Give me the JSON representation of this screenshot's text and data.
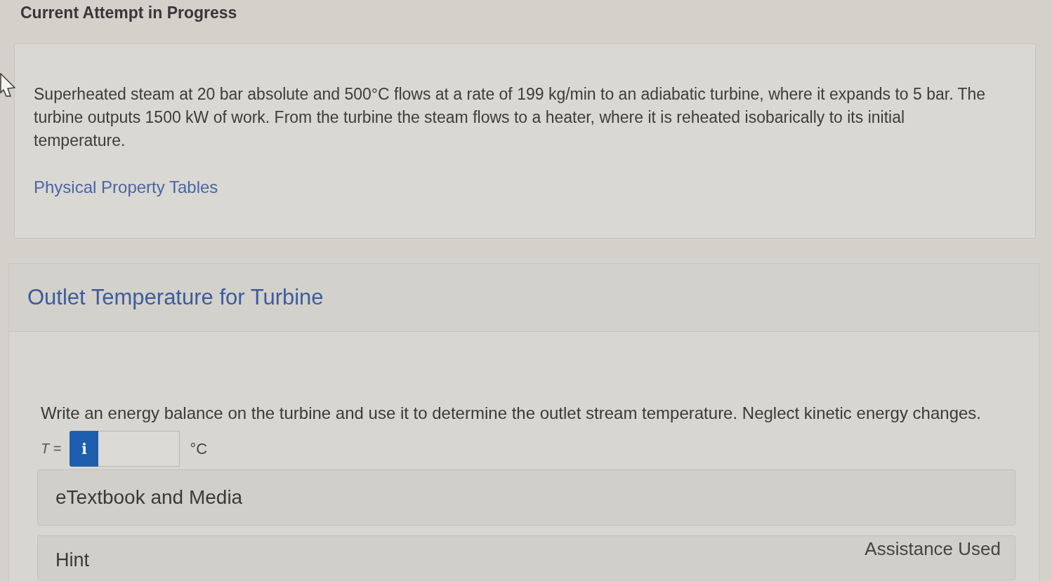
{
  "header": {
    "title": "Current Attempt in Progress"
  },
  "problem": {
    "text": "Superheated steam at 20 bar absolute and 500°C flows at a rate of 199 kg/min to an adiabatic turbine, where it expands to 5 bar. The turbine outputs 1500 kW of work. From the turbine the steam flows to a heater, where it is reheated isobarically to its initial temperature.",
    "link": "Physical Property Tables"
  },
  "part": {
    "title": "Outlet Temperature for Turbine",
    "question": "Write an energy balance on the turbine and use it to determine the outlet stream temperature. Neglect kinetic energy changes.",
    "answer": {
      "label": "*T* =",
      "info_button": "i",
      "unit": "°C"
    }
  },
  "resources": [
    {
      "label": "eTextbook and Media"
    },
    {
      "label": "Hint",
      "status": "Assistance Used"
    }
  ]
}
